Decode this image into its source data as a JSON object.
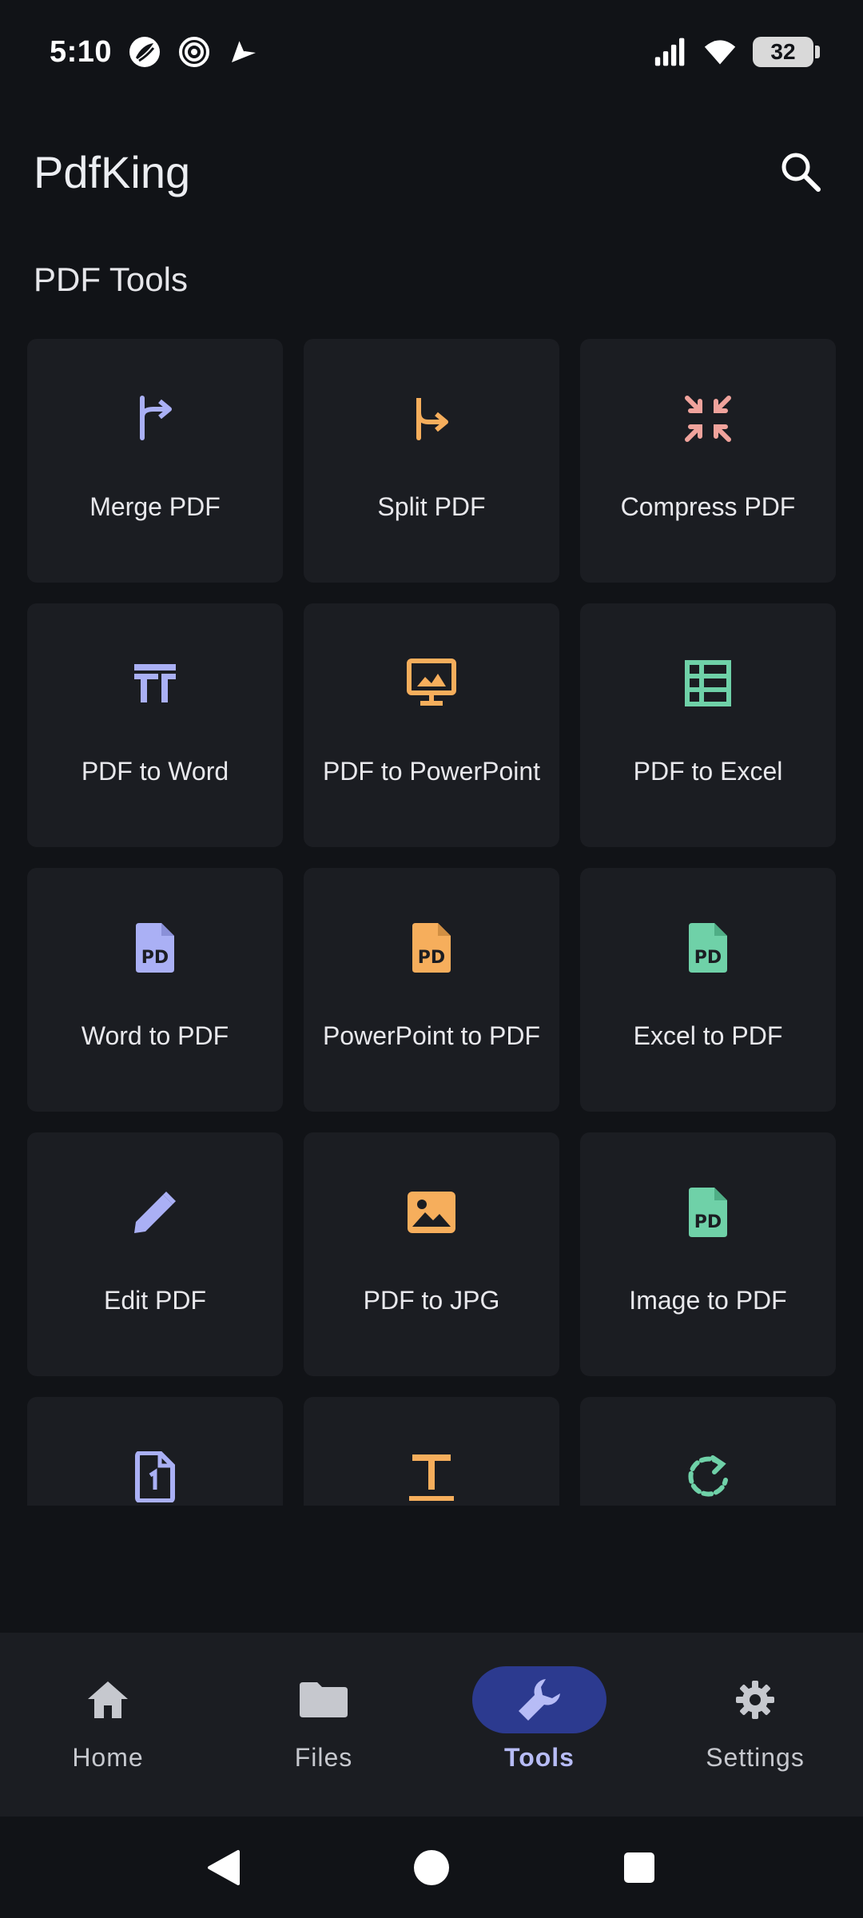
{
  "status_bar": {
    "time": "5:10",
    "battery": "32",
    "icons": [
      "sparkle-app-icon",
      "target-app-icon",
      "navigation-app-icon",
      "signal-icon",
      "wifi-icon",
      "battery-icon"
    ]
  },
  "app_bar": {
    "title": "PdfKing",
    "search_icon": "search-icon"
  },
  "section": {
    "title": "PDF Tools"
  },
  "colors": {
    "purple": "#aab0f5",
    "orange": "#f6ae5c",
    "red": "#f0a39c",
    "green": "#6fd1a8",
    "card": "#1b1d22",
    "background": "#111317",
    "nav_active_pill": "#2c3a8f",
    "nav_active_text": "#b7bcf6"
  },
  "tools": [
    {
      "label": "Merge PDF",
      "icon": "merge-icon",
      "color": "#aab0f5"
    },
    {
      "label": "Split PDF",
      "icon": "split-icon",
      "color": "#f6ae5c"
    },
    {
      "label": "Compress PDF",
      "icon": "compress-icon",
      "color": "#f0a39c"
    },
    {
      "label": "PDF to Word",
      "icon": "word-text-icon",
      "color": "#aab0f5"
    },
    {
      "label": "PDF to PowerPoint",
      "icon": "presentation-icon",
      "color": "#f6ae5c"
    },
    {
      "label": "PDF to Excel",
      "icon": "table-icon",
      "color": "#6fd1a8"
    },
    {
      "label": "Word to PDF",
      "icon": "pdf-file-icon",
      "color": "#aab0f5"
    },
    {
      "label": "PowerPoint to PDF",
      "icon": "pdf-file-icon",
      "color": "#f6ae5c"
    },
    {
      "label": "Excel to PDF",
      "icon": "pdf-file-icon",
      "color": "#6fd1a8"
    },
    {
      "label": "Edit PDF",
      "icon": "pencil-icon",
      "color": "#aab0f5"
    },
    {
      "label": "PDF to JPG",
      "icon": "image-icon",
      "color": "#f6ae5c"
    },
    {
      "label": "Image to PDF",
      "icon": "pdf-file-icon",
      "color": "#6fd1a8"
    },
    {
      "label": "",
      "icon": "page-number-icon",
      "color": "#aab0f5"
    },
    {
      "label": "",
      "icon": "text-icon",
      "color": "#f6ae5c"
    },
    {
      "label": "",
      "icon": "rotate-icon",
      "color": "#6fd1a8"
    }
  ],
  "bottom_nav": {
    "items": [
      {
        "label": "Home",
        "icon": "home-icon",
        "active": false
      },
      {
        "label": "Files",
        "icon": "folder-icon",
        "active": false
      },
      {
        "label": "Tools",
        "icon": "wrench-icon",
        "active": true
      },
      {
        "label": "Settings",
        "icon": "gear-icon",
        "active": false
      }
    ]
  },
  "system_nav": {
    "icons": [
      "back-icon",
      "home-circle-icon",
      "recents-icon"
    ]
  }
}
